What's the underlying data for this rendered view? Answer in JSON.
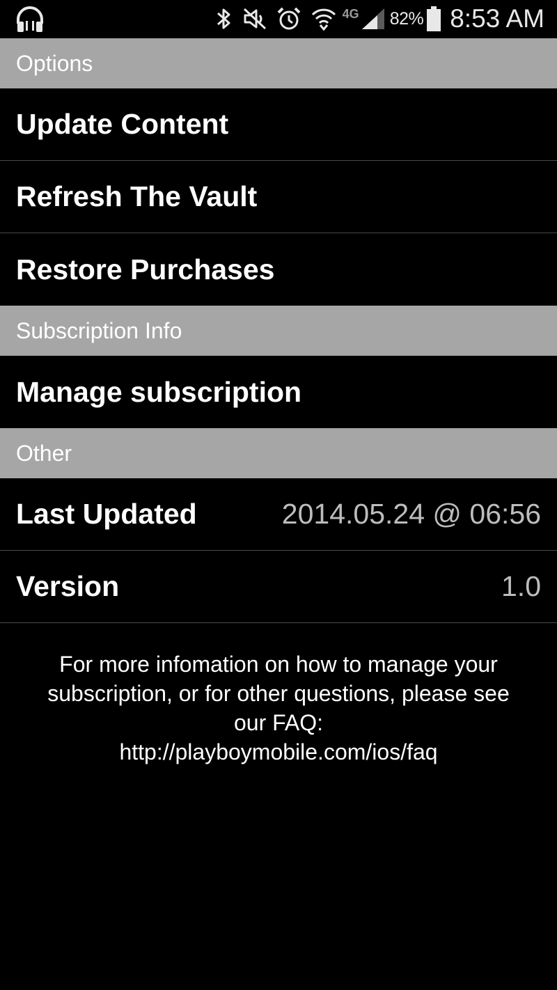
{
  "status_bar": {
    "battery_percent": "82%",
    "time": "8:53 AM",
    "network_label": "4G",
    "icons": [
      "headphones-icon",
      "bluetooth-icon",
      "mute-icon",
      "alarm-icon",
      "wifi-icon",
      "network-4g-icon",
      "signal-icon",
      "battery-icon"
    ]
  },
  "sections": {
    "options": {
      "header": "Options",
      "items": [
        {
          "label": "Update Content"
        },
        {
          "label": "Refresh The Vault"
        },
        {
          "label": "Restore Purchases"
        }
      ]
    },
    "subscription": {
      "header": "Subscription Info",
      "items": [
        {
          "label": "Manage subscription"
        }
      ]
    },
    "other": {
      "header": "Other",
      "last_updated": {
        "label": "Last Updated",
        "value": "2014.05.24 @ 06:56"
      },
      "version": {
        "label": "Version",
        "value": "1.0"
      }
    }
  },
  "footer": {
    "info_line1": "For more infomation on how to manage your",
    "info_line2": "subscription, or for other questions, please see",
    "info_line3": "our FAQ:",
    "faq_url": "http://playboymobile.com/ios/faq"
  },
  "colors": {
    "background": "#000000",
    "section_header_bg": "#a6a6a6",
    "text_primary": "#ffffff",
    "text_value": "#bdbdbd",
    "divider": "#4a4a4a"
  }
}
